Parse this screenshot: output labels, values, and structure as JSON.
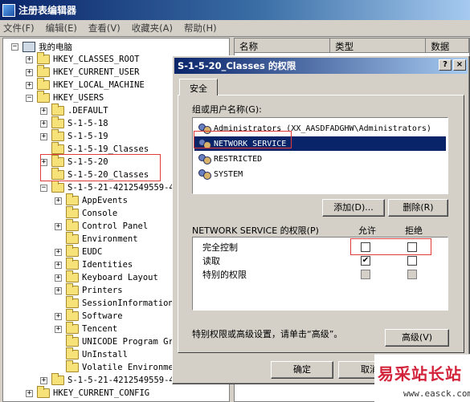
{
  "window": {
    "title": "注册表编辑器",
    "menu": [
      "文件(F)",
      "编辑(E)",
      "查看(V)",
      "收藏夹(A)",
      "帮助(H)"
    ]
  },
  "tree": {
    "nodes": [
      {
        "label": "我的电脑",
        "expander": "−",
        "icon": "computer"
      },
      {
        "label": "HKEY_CLASSES_ROOT",
        "expander": "+",
        "icon": "folder"
      },
      {
        "label": "HKEY_CURRENT_USER",
        "expander": "+",
        "icon": "folder"
      },
      {
        "label": "HKEY_LOCAL_MACHINE",
        "expander": "+",
        "icon": "folder"
      },
      {
        "label": "HKEY_USERS",
        "expander": "−",
        "icon": "folder"
      },
      {
        "label": ".DEFAULT",
        "expander": "+",
        "icon": "folder"
      },
      {
        "label": "S-1-5-18",
        "expander": "+",
        "icon": "folder"
      },
      {
        "label": "S-1-5-19",
        "expander": "+",
        "icon": "folder"
      },
      {
        "label": "S-1-5-19_Classes",
        "expander": "",
        "icon": "folder"
      },
      {
        "label": "S-1-5-20",
        "expander": "+",
        "icon": "folder"
      },
      {
        "label": "S-1-5-20_Classes",
        "expander": "",
        "icon": "folder-open"
      },
      {
        "label": "S-1-5-21-4212549559-4",
        "expander": "−",
        "icon": "folder"
      },
      {
        "label": "AppEvents",
        "expander": "+",
        "icon": "folder"
      },
      {
        "label": "Console",
        "expander": "",
        "icon": "folder"
      },
      {
        "label": "Control Panel",
        "expander": "+",
        "icon": "folder"
      },
      {
        "label": "Environment",
        "expander": "",
        "icon": "folder"
      },
      {
        "label": "EUDC",
        "expander": "+",
        "icon": "folder"
      },
      {
        "label": "Identities",
        "expander": "+",
        "icon": "folder"
      },
      {
        "label": "Keyboard Layout",
        "expander": "+",
        "icon": "folder"
      },
      {
        "label": "Printers",
        "expander": "+",
        "icon": "folder"
      },
      {
        "label": "SessionInformation",
        "expander": "",
        "icon": "folder"
      },
      {
        "label": "Software",
        "expander": "+",
        "icon": "folder"
      },
      {
        "label": "Tencent",
        "expander": "+",
        "icon": "folder"
      },
      {
        "label": "UNICODE Program Gr",
        "expander": "",
        "icon": "folder"
      },
      {
        "label": "UnInstall",
        "expander": "",
        "icon": "folder"
      },
      {
        "label": "Volatile Environme",
        "expander": "",
        "icon": "folder"
      },
      {
        "label": "S-1-5-21-4212549559-4",
        "expander": "+",
        "icon": "folder"
      },
      {
        "label": "HKEY_CURRENT_CONFIG",
        "expander": "+",
        "icon": "folder"
      }
    ]
  },
  "list": {
    "columns": [
      "名称",
      "类型",
      "数据"
    ]
  },
  "dialog": {
    "title": "S-1-5-20_Classes 的权限",
    "help_btn": "?",
    "close_btn": "×",
    "tab": "安全",
    "groups_label": "组或用户名称(G):",
    "users": [
      "Administrators (XX_AASDFADGHW\\Administrators)",
      "NETWORK SERVICE",
      "RESTRICTED",
      "SYSTEM"
    ],
    "selected_user_index": 1,
    "add_btn": "添加(D)...",
    "remove_btn": "删除(R)",
    "perm_label": "NETWORK SERVICE 的权限(P)",
    "allow_header": "允许",
    "deny_header": "拒绝",
    "permissions": [
      {
        "name": "完全控制",
        "allow": false,
        "deny": false,
        "disabled": false
      },
      {
        "name": "读取",
        "allow": true,
        "deny": false,
        "disabled": false
      },
      {
        "name": "特别的权限",
        "allow": false,
        "deny": false,
        "disabled": true
      }
    ],
    "advanced_note": "特别权限或高级设置，请单击“高级”。",
    "advanced_btn": "高级(V)",
    "ok_btn": "确定",
    "cancel_btn": "取消"
  },
  "watermark": {
    "logo": "易采站长站",
    "url": "www.easck.com"
  },
  "colors": {
    "selection": "#0a246a",
    "annotation": "#e53a3a"
  }
}
